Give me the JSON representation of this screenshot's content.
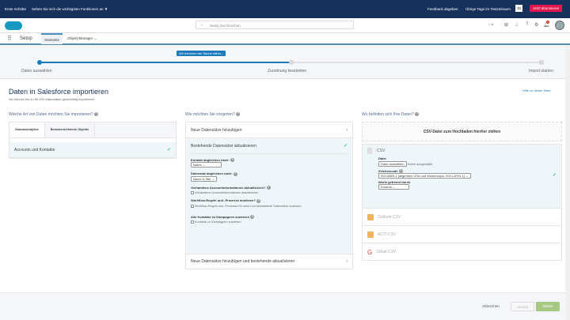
{
  "topbar": {
    "first_steps": "Erste Schritte",
    "features": "Sehen Sie sich die wichtigsten Funktionen an ▼",
    "feedback": "Feedback abgeben",
    "trial": "Übrige Tage im Testzeitraum",
    "days": "30",
    "subscribe": "Jetzt abonnieren"
  },
  "header": {
    "search_placeholder": "Setup durchsuchen",
    "notif_count": "1"
  },
  "nav": {
    "app": "Setup",
    "tabs": [
      "Startseite",
      "Objekt-Manager"
    ]
  },
  "progress": {
    "tooltip": "Wir kommen der Sache näher...",
    "steps": [
      "Daten auswählen",
      "Zuordnung bearbeiten",
      "Import starten"
    ],
    "percent": 50
  },
  "page": {
    "title": "Daten in Salesforce importieren",
    "subtitle": "Sie können bis zu 50.000 Datensätze gleichzeitig importieren.",
    "help": "Hilfe zu dieser Seite"
  },
  "left": {
    "question": "Welche Art von Daten möchten Sie importieren?",
    "tabs": [
      "Standardobjekte",
      "Benutzerdefinierte Objekte"
    ],
    "items": [
      "Accounts und Kontakte"
    ]
  },
  "middle": {
    "question": "Wie möchten Sie vorgehen?",
    "options": [
      "Neue Datensätze hinzufügen",
      "Bestehende Datensätze aktualisieren",
      "Neue Datensätze hinzufügen und bestehende aktualisieren"
    ],
    "match_contact_label": "Kontakt abgleichen nach:",
    "match_contact_value": "Name",
    "match_record_label": "Datensatz abgleichen nach:",
    "match_record_value": "Name & Site",
    "update_accounts_label": "Vorhandene Accountinformationen aktualisieren?",
    "update_accounts_cb": "Vorhandene Accountinformationen aktualisieren",
    "workflow_label": "Workflow-Regeln und -Prozesse auslösen?",
    "workflow_cb": "Workflow-Regeln und -Prozesse für neue und aktualisierte Datensätze auslösen",
    "campaign_label": "Alle Kontakte zu Kampagnen zuweisen",
    "campaign_cb": "Kontakte zu Kampagnen zuweisen"
  },
  "right": {
    "question": "Wo befinden sich Ihre Daten?",
    "drop": "CSV-Datei zum Hochladen hierher ziehen",
    "csv": "CSV",
    "file_label": "Datei",
    "file_button": "Datei auswählen",
    "file_none": "Keine ausgewählt",
    "encoding_label": "Zeichencode",
    "encoding_value": "ISO-8859-1 (allgemein USA und Westeuropa: ISO-LATIN-1)",
    "sep_label": "Werte getrennt durch",
    "sep_value": "Komma",
    "sources": [
      "Outlook-CSV",
      "ACT!-CSV",
      "GMail-CSV"
    ]
  },
  "footer": {
    "cancel": "Abbrechen",
    "back": "Zurück",
    "next": "Weiter"
  }
}
